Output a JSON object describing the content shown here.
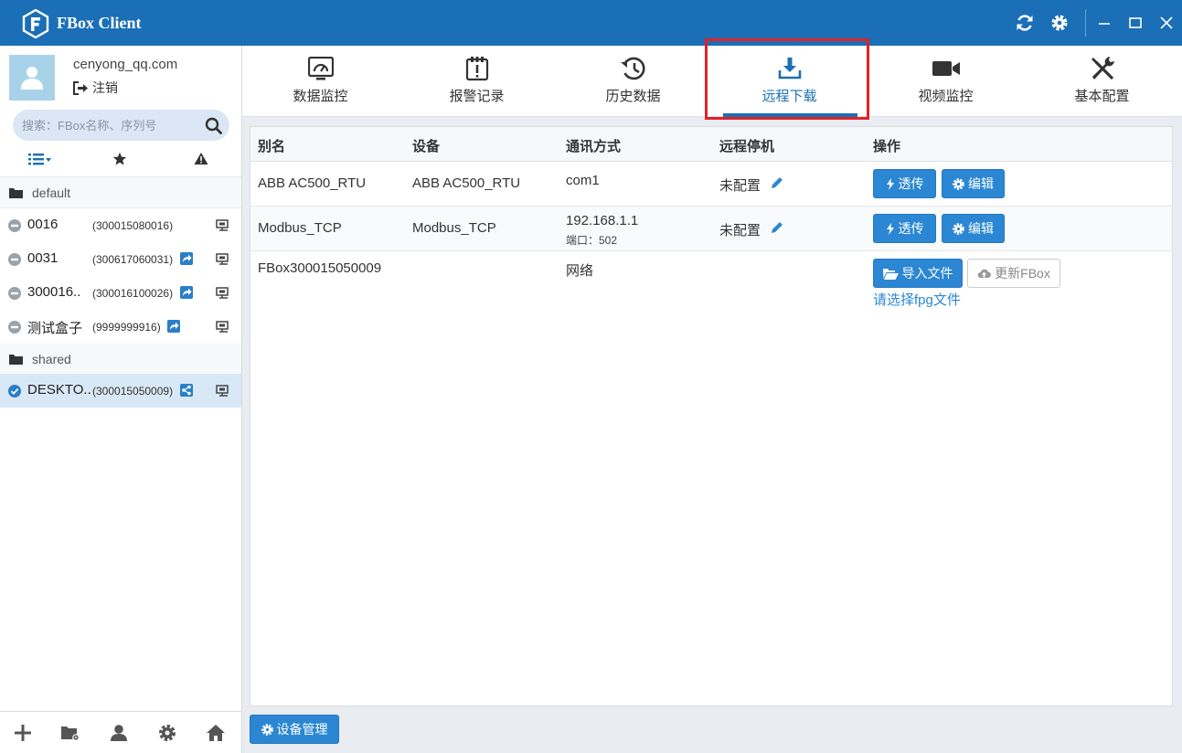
{
  "app": {
    "title": "FBox Client"
  },
  "user": {
    "email": "cenyong_qq.com",
    "logout_label": "注销"
  },
  "search": {
    "placeholder": "搜索：FBox名称、序列号"
  },
  "groups": [
    {
      "name": "default"
    },
    {
      "name": "shared"
    }
  ],
  "devices": [
    {
      "name": "0016",
      "serial": "(300015080016)",
      "status": "offline",
      "selected": false
    },
    {
      "name": "0031",
      "serial": "(300617060031)",
      "status": "offline",
      "selected": false
    },
    {
      "name": "300016..",
      "serial": "(300016100026)",
      "status": "offline",
      "selected": false
    },
    {
      "name": "测试盒子",
      "serial": "(9999999916)",
      "status": "offline",
      "selected": false
    },
    {
      "name": "DESKTO..",
      "serial": "(300015050009)",
      "status": "online",
      "selected": true
    }
  ],
  "tabs": [
    {
      "label": "数据监控",
      "icon": "monitor-gauge-icon"
    },
    {
      "label": "报警记录",
      "icon": "alarm-clipboard-icon"
    },
    {
      "label": "历史数据",
      "icon": "history-clock-icon"
    },
    {
      "label": "远程下载",
      "icon": "download-tray-icon",
      "active": true
    },
    {
      "label": "视频监控",
      "icon": "video-camera-icon"
    },
    {
      "label": "基本配置",
      "icon": "tools-icon"
    }
  ],
  "table": {
    "headers": [
      "别名",
      "设备",
      "通讯方式",
      "远程停机",
      "操作"
    ],
    "rows": [
      {
        "alias": "ABB AC500_RTU",
        "device": "ABB AC500_RTU",
        "comm": "com1",
        "comm_sub": "",
        "stop": "未配置"
      },
      {
        "alias": "Modbus_TCP",
        "device": "Modbus_TCP",
        "comm": "192.168.1.1",
        "comm_sub": "端口：502",
        "stop": "未配置"
      },
      {
        "alias": "FBox300015050009",
        "device": "",
        "comm": "网络",
        "comm_sub": "",
        "stop": ""
      }
    ],
    "btn_passthrough": "透传",
    "btn_edit": "编辑",
    "btn_import": "导入文件",
    "btn_update": "更新FBox",
    "select_file_link": "请选择fpg文件"
  },
  "footer": {
    "device_manage_label": "设备管理"
  },
  "colors": {
    "primary": "#1a6fb6",
    "button": "#2b87d3",
    "highlight": "#e0222a"
  }
}
